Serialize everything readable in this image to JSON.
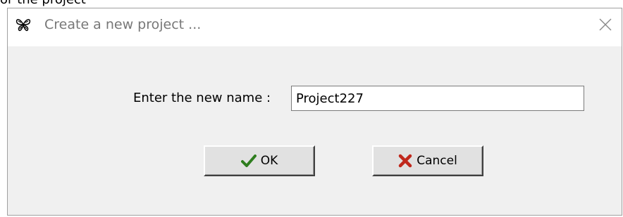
{
  "background_text": "or the project",
  "dialog": {
    "title": "Create a new project ...",
    "app_icon": "butterfly-icon",
    "close_icon": "close-icon",
    "close_glyph": "✕"
  },
  "form": {
    "label": "Enter the new name :",
    "name_value": "Project227"
  },
  "buttons": {
    "ok": {
      "label": "OK",
      "icon": "checkmark-icon",
      "color": "#2e7d1e"
    },
    "cancel": {
      "label": "Cancel",
      "icon": "x-mark-icon",
      "color": "#c0281c"
    }
  }
}
